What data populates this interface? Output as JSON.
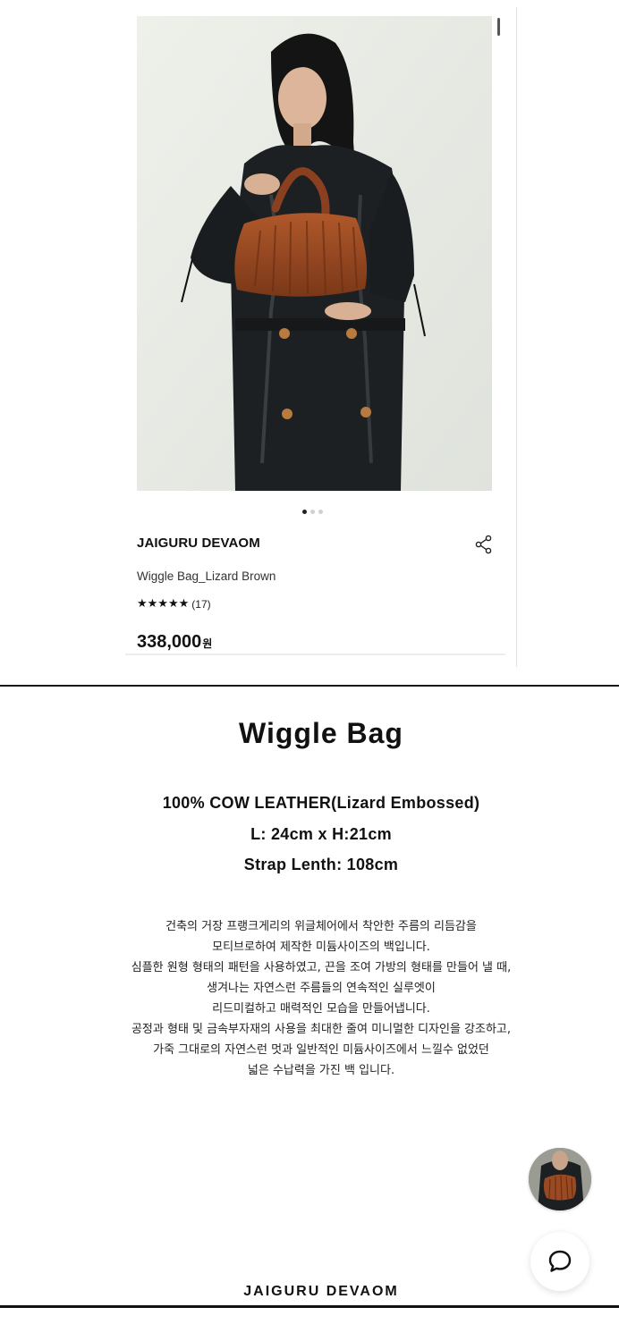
{
  "product": {
    "brand": "JAIGURU DEVAOM",
    "name": "Wiggle Bag_Lizard Brown",
    "stars": "★★★★★",
    "review_count": "(17)",
    "rating_value": 5,
    "price": "338,000",
    "currency": "원",
    "carousel": {
      "total": 3,
      "active_index": 0
    }
  },
  "detail": {
    "title": "Wiggle Bag",
    "specs": [
      "100% COW LEATHER(Lizard Embossed)",
      "L: 24cm x H:21cm",
      "Strap Lenth: 108cm"
    ],
    "description": [
      "건축의 거장 프랭크게리의 위글체어에서 착안한 주름의 리듬감을",
      "모티브로하여 제작한 미듐사이즈의 백입니다.",
      "심플한 원형 형태의 패턴을 사용하였고, 끈을 조여 가방의 형태를 만들어 낼 때,",
      "생겨나는 자연스런 주름들의 연속적인 실루엣이",
      "리드미컬하고 매력적인 모습을 만들어냅니다.",
      "공정과 형태 및 금속부자재의 사용을 최대한 줄여 미니멀한 디자인을 강조하고,",
      "가죽 그대로의 자연스런 멋과 일반적인 미듐사이즈에서 느낄수 없었던",
      "넓은 수납력을 가진 백 입니다."
    ],
    "footer_brand": "JAIGURU DEVAOM"
  },
  "icons": {
    "expand": "expand-arrows-icon",
    "share": "share-icon",
    "chat": "chat-bubble-icon"
  },
  "colors": {
    "bag_brown": "#9a4a22",
    "coat_black": "#1d2022",
    "photo_bg": "#e8ebe5"
  }
}
